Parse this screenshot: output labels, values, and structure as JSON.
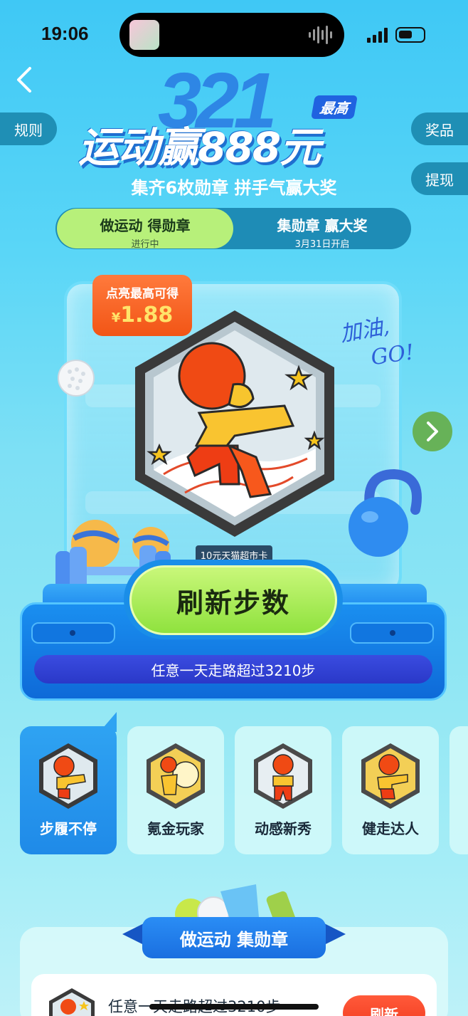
{
  "status_bar": {
    "time": "19:06"
  },
  "side_buttons": {
    "rules": "规则",
    "prizes": "奖品",
    "withdraw": "提现"
  },
  "hero": {
    "bg_numbers": "321",
    "max_badge": "最高",
    "headline": "运动赢888元",
    "subhead": "集齐6枚勋章  拼手气赢大奖"
  },
  "tabs": [
    {
      "title": "做运动 得勋章",
      "sub": "进行中"
    },
    {
      "title": "集勋章 赢大奖",
      "sub": "3月31日开启"
    }
  ],
  "showcase": {
    "reward_title": "点亮最高可得",
    "reward_currency": "¥",
    "reward_value": "1.88",
    "cheer_line1": "加油,",
    "cheer_line2": "GO!",
    "prize_label": "10元天猫超市卡"
  },
  "action": {
    "refresh_label": "刷新步数",
    "task_text": "任意一天走路超过3210步"
  },
  "medals": [
    {
      "name": "步履不停",
      "active": true
    },
    {
      "name": "氪金玩家",
      "active": false
    },
    {
      "name": "动感新秀",
      "active": false
    },
    {
      "name": "健走达人",
      "active": false
    }
  ],
  "bottom": {
    "ribbon": "做运动 集勋章",
    "task_row_text": "任意一天走路超过3210步",
    "task_row_button": "刷新"
  },
  "colors": {
    "accent_green": "#b7f07a",
    "accent_blue": "#1a8ee8",
    "reward_orange": "#f25516",
    "medal_frame": "#3a3a3a"
  }
}
